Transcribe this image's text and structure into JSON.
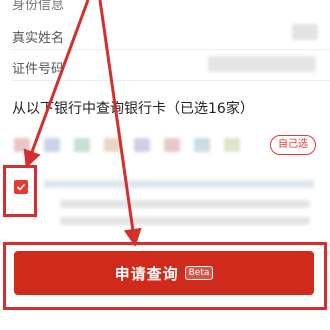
{
  "identity_section": {
    "heading": "身份信息",
    "fields": [
      {
        "label": "真实姓名"
      },
      {
        "label": "证件号码"
      }
    ]
  },
  "bank_query": {
    "title": "从以下银行中查询银行卡（已选16家）",
    "self_select_label": "自己选"
  },
  "agreement": {
    "checked": true
  },
  "apply_button": {
    "label": "申请查询",
    "badge": "Beta"
  },
  "annotation": {
    "color": "#d32f2f"
  }
}
